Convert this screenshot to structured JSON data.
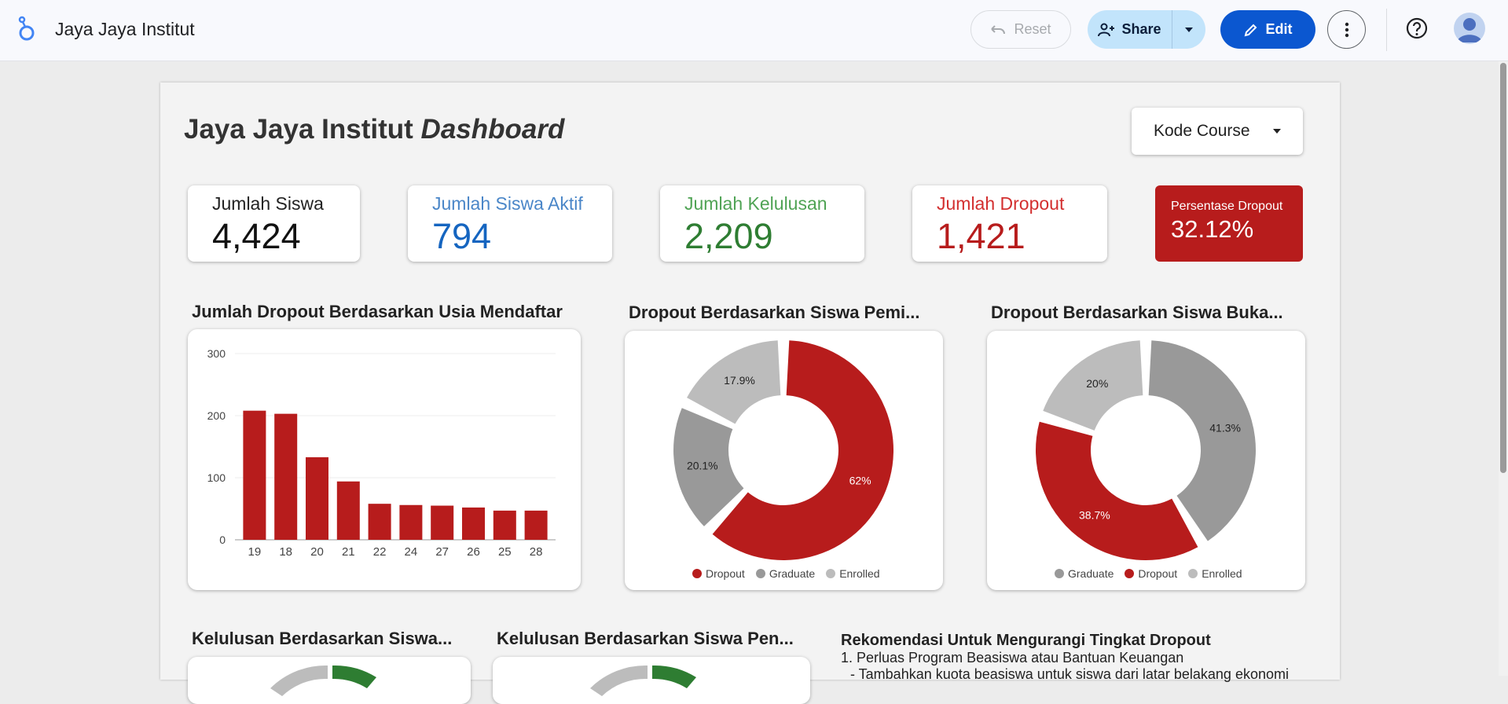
{
  "app": {
    "title": "Jaya Jaya Institut"
  },
  "toolbar": {
    "reset_label": "Reset",
    "share_label": "Share",
    "edit_label": "Edit"
  },
  "icons": [
    "looker-logo",
    "undo-icon",
    "add-person-icon",
    "caret-down-icon",
    "pencil-icon",
    "more-vert-icon",
    "help-icon",
    "avatar-icon"
  ],
  "colors": {
    "accent": "#0b57d0",
    "dropout": "#b71c1c",
    "graduate": "#999999",
    "enrolled": "#bcbcbc",
    "blue": "#1565c0",
    "green": "#2e7d32",
    "share_bg": "#c2e4fb"
  },
  "dashboard": {
    "title_main": "Jaya Jaya Institut ",
    "title_em": "Dashboard",
    "filter_label": "Kode Course",
    "kpis": [
      {
        "label": "Jumlah Siswa",
        "value": "4,424"
      },
      {
        "label": "Jumlah Siswa Aktif",
        "value": "794"
      },
      {
        "label": "Jumlah Kelulusan",
        "value": "2,209"
      },
      {
        "label": "Jumlah Dropout",
        "value": "1,421"
      }
    ],
    "pct_kpi": {
      "label": "Persentase Dropout",
      "value": "32.12%"
    },
    "chart_titles": {
      "bar": "Jumlah Dropout Berdasarkan Usia Mendaftar",
      "donut1": "Dropout Berdasarkan Siswa Pemi...",
      "donut2": "Dropout Berdasarkan Siswa Buka...",
      "bottom1": "Kelulusan Berdasarkan Siswa...",
      "bottom2": "Kelulusan Berdasarkan Siswa Pen..."
    },
    "recommendation": {
      "title": "Rekomendasi Untuk Mengurangi Tingkat Dropout",
      "line1": "1. Perluas Program Beasiswa atau Bantuan Keuangan",
      "line2": "- Tambahkan kuota beasiswa untuk siswa dari latar belakang ekonomi"
    }
  },
  "chart_data": [
    {
      "type": "bar",
      "title": "Jumlah Dropout Berdasarkan Usia Mendaftar",
      "categories": [
        "19",
        "18",
        "20",
        "21",
        "22",
        "24",
        "27",
        "26",
        "25",
        "28"
      ],
      "values": [
        208,
        203,
        133,
        94,
        58,
        56,
        55,
        52,
        47,
        47
      ],
      "ylim": [
        0,
        300
      ],
      "yticks": [
        "0",
        "100",
        "200",
        "300"
      ],
      "grid": true,
      "color": "#b71c1c"
    },
    {
      "type": "pie",
      "title": "Dropout Berdasarkan Siswa Pemi...",
      "labels": [
        "Dropout",
        "Graduate",
        "Enrolled"
      ],
      "values": [
        62,
        20.1,
        17.9
      ],
      "value_labels": [
        "62%",
        "20.1%",
        "17.9%"
      ],
      "colors": [
        "#b71c1c",
        "#999999",
        "#bcbcbc"
      ],
      "legend": [
        "Dropout",
        "Graduate",
        "Enrolled"
      ],
      "legend_position": "bottom"
    },
    {
      "type": "pie",
      "title": "Dropout Berdasarkan Siswa Buka...",
      "labels": [
        "Graduate",
        "Dropout",
        "Enrolled"
      ],
      "values": [
        41.3,
        38.7,
        20
      ],
      "value_labels": [
        "41.3%",
        "38.7%",
        "20%"
      ],
      "colors": [
        "#999999",
        "#b71c1c",
        "#bcbcbc"
      ],
      "legend": [
        "Graduate",
        "Dropout",
        "Enrolled"
      ],
      "legend_position": "bottom"
    }
  ]
}
